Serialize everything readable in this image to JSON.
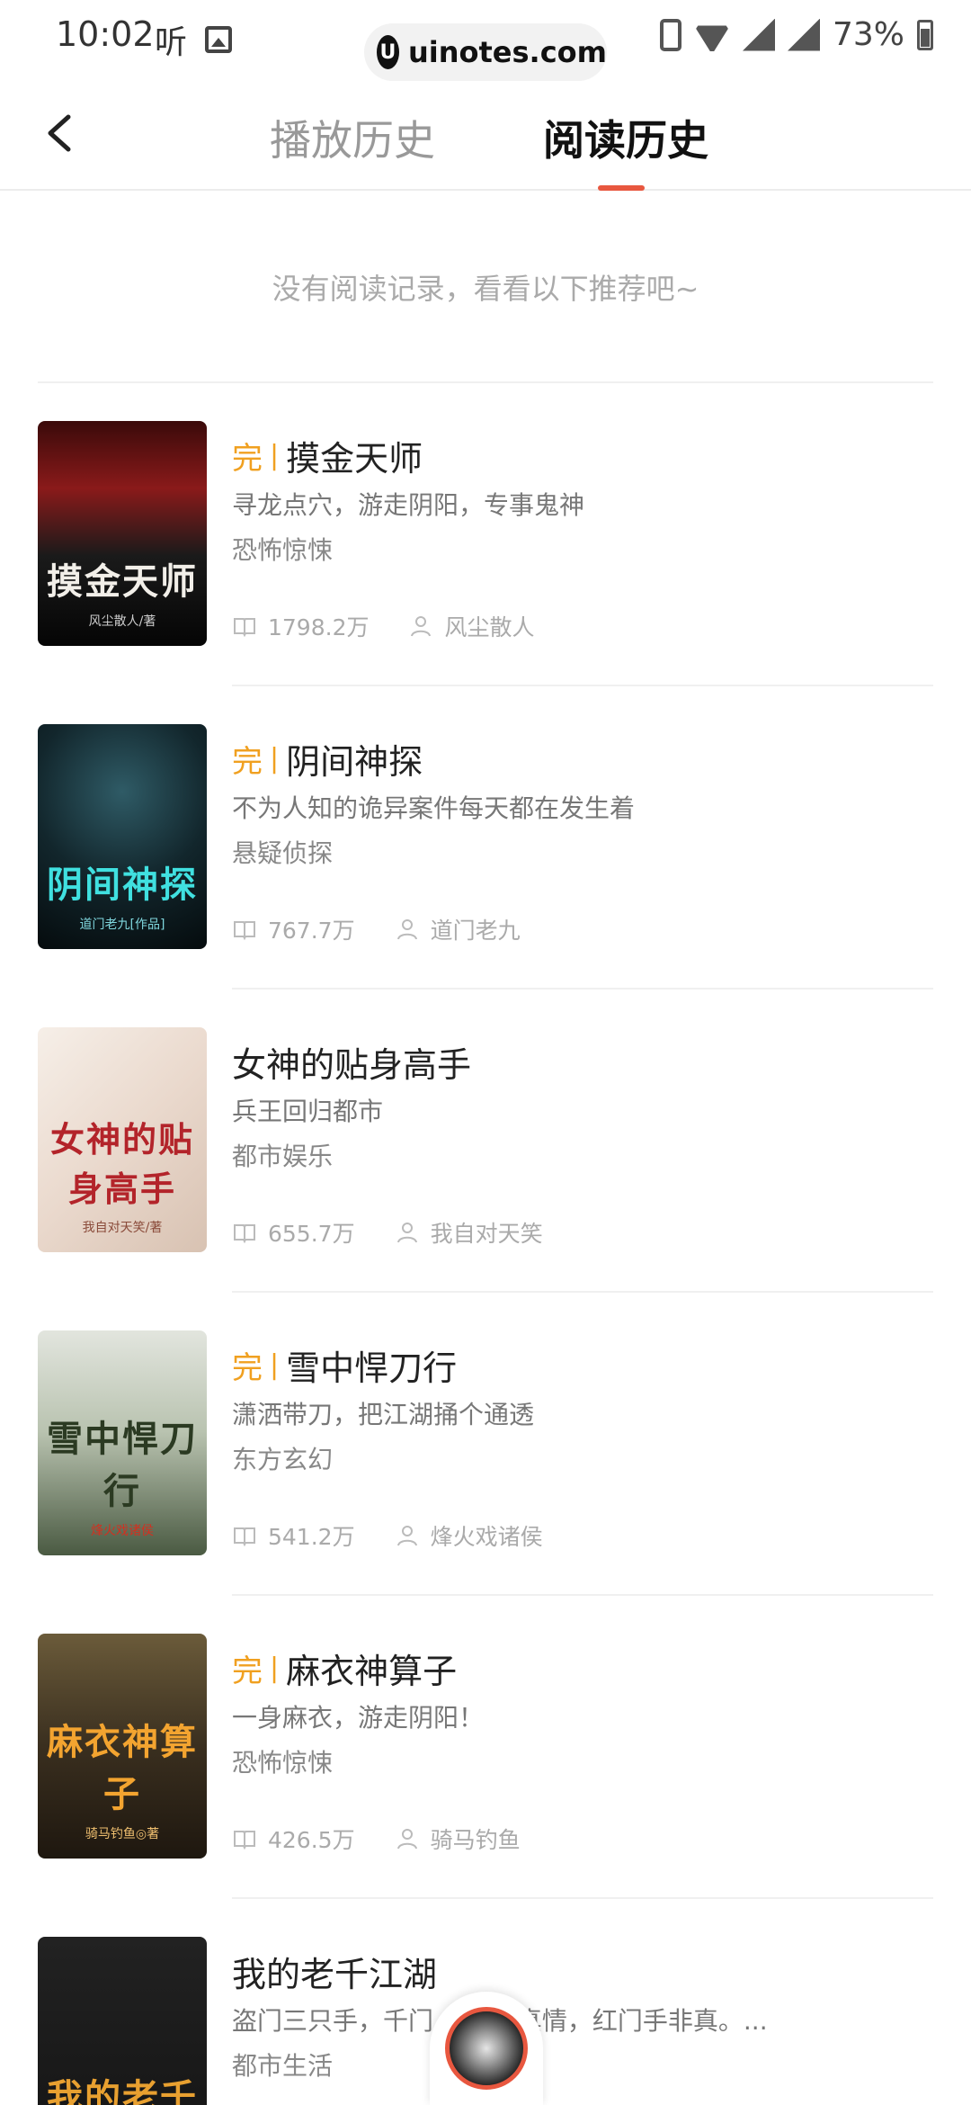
{
  "status_bar": {
    "time": "10:02",
    "listen_icon_text": "听",
    "url": "uinotes.com",
    "url_logo": "U",
    "battery": "73%"
  },
  "header": {
    "tabs": [
      {
        "label": "播放历史",
        "active": false
      },
      {
        "label": "阅读历史",
        "active": true
      }
    ],
    "accent_color": "#e8573f"
  },
  "empty_hint": "没有阅读记录，看看以下推荐吧~",
  "books": [
    {
      "complete": true,
      "complete_label": "完",
      "title": "摸金天师",
      "desc": "寻龙点穴，游走阴阳，专事鬼神",
      "genre": "恐怖惊悚",
      "reads": "1798.2万",
      "author": "风尘散人",
      "cover_text": "摸金天师",
      "cover_author": "风尘散人/著"
    },
    {
      "complete": true,
      "complete_label": "完",
      "title": "阴间神探",
      "desc": "不为人知的诡异案件每天都在发生着",
      "genre": "悬疑侦探",
      "reads": "767.7万",
      "author": "道门老九",
      "cover_text": "阴间神探",
      "cover_author": "道门老九[作品]"
    },
    {
      "complete": false,
      "complete_label": "",
      "title": "女神的贴身高手",
      "desc": "兵王回归都市",
      "genre": "都市娱乐",
      "reads": "655.7万",
      "author": "我自对天笑",
      "cover_text": "女神的贴身高手",
      "cover_author": "我自对天笑/著"
    },
    {
      "complete": true,
      "complete_label": "完",
      "title": "雪中悍刀行",
      "desc": "潇洒带刀，把江湖捅个通透",
      "genre": "东方玄幻",
      "reads": "541.2万",
      "author": "烽火戏诸侯",
      "cover_text": "雪中悍刀行",
      "cover_author": "烽火戏诸侯"
    },
    {
      "complete": true,
      "complete_label": "完",
      "title": "麻衣神算子",
      "desc": "一身麻衣，游走阴阳！",
      "genre": "恐怖惊悚",
      "reads": "426.5万",
      "author": "骑马钓鱼",
      "cover_text": "麻衣神算子",
      "cover_author": "骑马钓鱼◎著"
    },
    {
      "complete": false,
      "complete_label": "",
      "title": "我的老千江湖",
      "desc": "盗门三只手，千门 兰花无真情，红门手非真。...",
      "genre": "都市生活",
      "reads": "",
      "author": "",
      "cover_text": "我的老千",
      "cover_author": ""
    }
  ]
}
